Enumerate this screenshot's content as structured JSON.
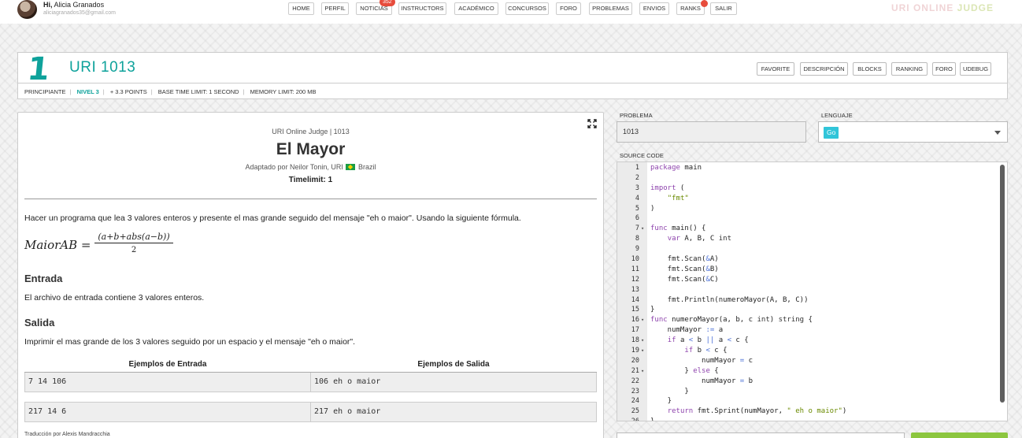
{
  "user": {
    "greeting_bold": "Hi,",
    "name": "Alicia Granados",
    "email": "aliciagranados35@gmail.com"
  },
  "nav": {
    "items": [
      "HOME",
      "PERFIL",
      "NOTICIAS",
      "INSTRUCTORS",
      "ACADÉMICO",
      "CONCURSOS",
      "FORO",
      "PROBLEMAS",
      "ENVIOS",
      "RANKS",
      "SALIR"
    ],
    "news_badge": "352"
  },
  "brand": {
    "part1": "URI ONLINE",
    "part2": "JUDGE"
  },
  "problem": {
    "logo_num": "1",
    "title": "URI 1013",
    "header_buttons": [
      "FAVORITE",
      "DESCRIPCIÓN",
      "BLOCKS",
      "RANKING",
      "FORO",
      "UDEBUG"
    ],
    "meta": {
      "category": "PRINCIPIANTE",
      "level": "NIVEL 3",
      "points": "+ 3.3 POINTS",
      "time_limit": "BASE TIME LIMIT: 1 SECOND",
      "memory_limit": "MEMORY LIMIT: 200 MB"
    }
  },
  "description": {
    "source": "URI Online Judge | 1013",
    "heading": "El Mayor",
    "adapted_prefix": "Adaptado por Neilor Tonin, URI",
    "adapted_country": "Brazil",
    "timelimit": "Timelimit: 1",
    "intro": "Hacer un programa que lea 3 valores enteros y presente el mas grande seguido del mensaje \"eh o maior\". Usando la siguiente fórmula.",
    "formula_lhs": "MaiorAB =",
    "formula_numerator": "(a+b+abs(a−b))",
    "formula_denominator": "2",
    "input_title": "Entrada",
    "input_text": "El archivo de entrada contiene 3 valores enteros.",
    "output_title": "Salida",
    "output_text": "Imprimir el mas grande de los 3 valores seguido por un espacio y el mensaje \"eh o maior\".",
    "table_headers": [
      "Ejemplos de Entrada",
      "Ejemplos de Salida"
    ],
    "examples": [
      {
        "input": "7 14 106",
        "output": "106 eh o maior"
      },
      {
        "input": "217 14 6",
        "output": "217 eh o maior"
      }
    ],
    "credit": "Traducción por Alexis Mandracchia"
  },
  "form": {
    "problem_label": "PROBLEMA",
    "problem_value": "1013",
    "language_label": "LENGUAJE",
    "language_value": "Go",
    "source_label": "SOURCE CODE"
  },
  "code_lines": [
    "package main",
    "",
    "import (",
    "    \"fmt\"",
    ")",
    "",
    "func main() {",
    "    var A, B, C int",
    "",
    "    fmt.Scan(&A)",
    "    fmt.Scan(&B)",
    "    fmt.Scan(&C)",
    "",
    "    fmt.Println(numeroMayor(A, B, C))",
    "}",
    "func numeroMayor(a, b, c int) string {",
    "    numMayor := a",
    "    if a < b || a < c {",
    "        if b < c {",
    "            numMayor = c",
    "        } else {",
    "            numMayor = b",
    "        }",
    "    }",
    "    return fmt.Sprint(numMayor, \" eh o maior\")",
    "}"
  ],
  "fold_lines": [
    7,
    16,
    18,
    19,
    21
  ],
  "colors": {
    "accent": "#0ea29b",
    "keyword": "#8e44ad",
    "string": "#6a8a00",
    "operator": "#4a6fd6",
    "badge": "#e74c3c",
    "submit": "#8cc63f"
  }
}
